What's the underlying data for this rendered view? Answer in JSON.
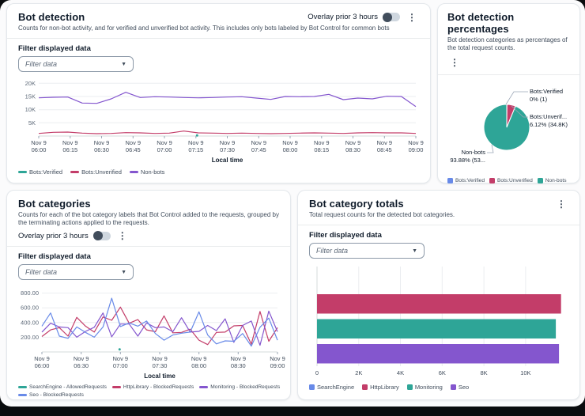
{
  "colors": {
    "blue": "#688AE8",
    "crimson": "#C33D69",
    "teal": "#2EA597",
    "purple": "#8456CE"
  },
  "panels": {
    "bot_detection": {
      "title": "Bot detection",
      "subtitle": "Counts for non-bot activity, and for verified and unverified bot activity. This includes only bots labeled by Bot Control for common bots",
      "overlay_label": "Overlay prior 3 hours",
      "filter_label": "Filter displayed data",
      "filter_placeholder": "Filter data",
      "x_axis_title": "Local time"
    },
    "bot_detection_percentages": {
      "title": "Bot detection percentages",
      "subtitle": "Bot detection categories as percentages of the total request counts."
    },
    "bot_categories": {
      "title": "Bot categories",
      "subtitle": "Counts for each of the bot category labels that Bot Control added to the requests, grouped by the terminating actions applied to the requests.",
      "overlay_label": "Overlay prior 3 hours",
      "filter_label": "Filter displayed data",
      "filter_placeholder": "Filter data",
      "x_axis_title": "Local time"
    },
    "bot_category_totals": {
      "title": "Bot category totals",
      "subtitle": "Total request counts for the detected bot categories.",
      "filter_label": "Filter displayed data",
      "filter_placeholder": "Filter data"
    }
  },
  "chart_data": [
    {
      "type": "line",
      "title": "Bot detection",
      "xlabel": "Local time",
      "x_date": "Nov 9",
      "x_ticks": [
        "06:00",
        "06:15",
        "06:30",
        "06:45",
        "07:00",
        "07:15",
        "07:30",
        "07:45",
        "08:00",
        "08:15",
        "08:30",
        "08:45",
        "09:00"
      ],
      "ylim": [
        0,
        21000
      ],
      "y_ticks": [
        {
          "v": 5000,
          "label": "5K"
        },
        {
          "v": 10000,
          "label": "10K"
        },
        {
          "v": 15000,
          "label": "15K"
        },
        {
          "v": 20000,
          "label": "20K"
        }
      ],
      "series": [
        {
          "name": "Bots:Verified",
          "color": "#2EA597",
          "values": null,
          "point": {
            "fx": 0.42,
            "v": 250
          }
        },
        {
          "name": "Bots:Unverified",
          "color": "#C33D69",
          "values": [
            1000,
            1400,
            1500,
            1100,
            900,
            1000,
            1300,
            1200,
            1000,
            1100,
            1900,
            1200,
            1100,
            1000,
            1100,
            1000,
            900,
            1000,
            1100,
            1200,
            1100,
            1000,
            1200,
            1300,
            1200,
            1200,
            1000
          ]
        },
        {
          "name": "Non-bots",
          "color": "#8456CE",
          "values": [
            14500,
            14700,
            14800,
            12500,
            12400,
            14100,
            16600,
            14600,
            14900,
            14800,
            14600,
            14500,
            14600,
            14800,
            14900,
            14400,
            13900,
            15000,
            14900,
            15000,
            15800,
            13800,
            14400,
            14100,
            15100,
            15000,
            11200
          ]
        }
      ],
      "legend_rows": [
        [
          {
            "label": "Bots:Verified",
            "color": "#2EA597",
            "marker": "line"
          },
          {
            "label": "Bots:Unverified",
            "color": "#C33D69",
            "marker": "line"
          },
          {
            "label": "Non-bots",
            "color": "#8456CE",
            "marker": "line"
          }
        ]
      ]
    },
    {
      "type": "pie",
      "title": "Bot detection percentages",
      "slices": [
        {
          "name": "Bots:Verified",
          "pct": 0.15,
          "color": "#688AE8",
          "callout_label": "Bots:Verified",
          "count_label": "0% (1)"
        },
        {
          "name": "Bots:Unverified",
          "pct": 6.12,
          "color": "#C33D69",
          "callout_label": "Bots:Unverif...",
          "count_label": "6.12% (34.8K)"
        },
        {
          "name": "Non-bots",
          "pct": 93.73,
          "color": "#2EA597",
          "callout_label": "Non-bots",
          "count_label": "93.88% (53..."
        }
      ],
      "legend_rows": [
        [
          {
            "label": "Bots:Verified",
            "color": "#688AE8",
            "marker": "square"
          },
          {
            "label": "Bots:Unverified",
            "color": "#C33D69",
            "marker": "square"
          },
          {
            "label": "Non-bots",
            "color": "#2EA597",
            "marker": "square"
          }
        ]
      ]
    },
    {
      "type": "line",
      "title": "Bot categories",
      "xlabel": "Local time",
      "x_date": "Nov 9",
      "x_ticks": [
        "06:00",
        "06:30",
        "07:00",
        "07:30",
        "08:00",
        "08:30",
        "09:00"
      ],
      "ylim": [
        0,
        860
      ],
      "y_ticks": [
        {
          "v": 200,
          "label": "200.00"
        },
        {
          "v": 400,
          "label": "400.00"
        },
        {
          "v": 600,
          "label": "600.00"
        },
        {
          "v": 800,
          "label": "800.00"
        }
      ],
      "series": [
        {
          "name": "SearchEngine - AllowedRequests",
          "color": "#2EA597",
          "values": null,
          "point": {
            "fx": 0.33,
            "v": 35
          }
        },
        {
          "name": "HttpLibrary - BlockedRequests",
          "color": "#C33D69",
          "values": [
            210,
            300,
            330,
            215,
            470,
            350,
            270,
            475,
            430,
            610,
            390,
            440,
            300,
            275,
            490,
            260,
            265,
            310,
            160,
            100,
            265,
            270,
            355,
            360,
            105,
            550,
            145,
            330
          ]
        },
        {
          "name": "Monitoring - BlockedRequests",
          "color": "#8456CE",
          "values": [
            270,
            390,
            340,
            330,
            200,
            280,
            335,
            530,
            205,
            380,
            380,
            215,
            395,
            330,
            340,
            275,
            465,
            270,
            280,
            360,
            290,
            450,
            130,
            360,
            420,
            90,
            555,
            275
          ]
        },
        {
          "name": "Seo - BlockedRequests",
          "color": "#688AE8",
          "values": [
            350,
            530,
            215,
            185,
            340,
            265,
            200,
            340,
            730,
            345,
            395,
            350,
            420,
            250,
            160,
            230,
            255,
            270,
            545,
            230,
            110,
            150,
            145,
            250,
            80,
            335,
            460,
            160
          ]
        }
      ],
      "legend_rows": [
        [
          {
            "label": "SearchEngine - AllowedRequests",
            "color": "#2EA597",
            "marker": "line"
          },
          {
            "label": "HttpLibrary - BlockedRequests",
            "color": "#C33D69",
            "marker": "line"
          },
          {
            "label": "Monitoring - BlockedRequests",
            "color": "#8456CE",
            "marker": "line"
          }
        ],
        [
          {
            "label": "Seo - BlockedRequests",
            "color": "#688AE8",
            "marker": "line"
          }
        ]
      ]
    },
    {
      "type": "bar",
      "title": "Bot category totals",
      "orientation": "horizontal",
      "categories": [
        "SearchEngine",
        "HttpLibrary",
        "Monitoring",
        "Seo"
      ],
      "values": [
        1,
        11700,
        11450,
        11600
      ],
      "colors": [
        "#688AE8",
        "#C33D69",
        "#2EA597",
        "#8456CE"
      ],
      "xlim": [
        0,
        11900
      ],
      "x_ticks": [
        {
          "v": 0,
          "label": "0"
        },
        {
          "v": 2000,
          "label": "2K"
        },
        {
          "v": 4000,
          "label": "4K"
        },
        {
          "v": 6000,
          "label": "6K"
        },
        {
          "v": 8000,
          "label": "8K"
        },
        {
          "v": 10000,
          "label": "10K"
        }
      ],
      "legend_rows": [
        [
          {
            "label": "SearchEngine",
            "color": "#688AE8",
            "marker": "square"
          },
          {
            "label": "HttpLibrary",
            "color": "#C33D69",
            "marker": "square"
          },
          {
            "label": "Monitoring",
            "color": "#2EA597",
            "marker": "square"
          },
          {
            "label": "Seo",
            "color": "#8456CE",
            "marker": "square"
          }
        ]
      ]
    }
  ]
}
